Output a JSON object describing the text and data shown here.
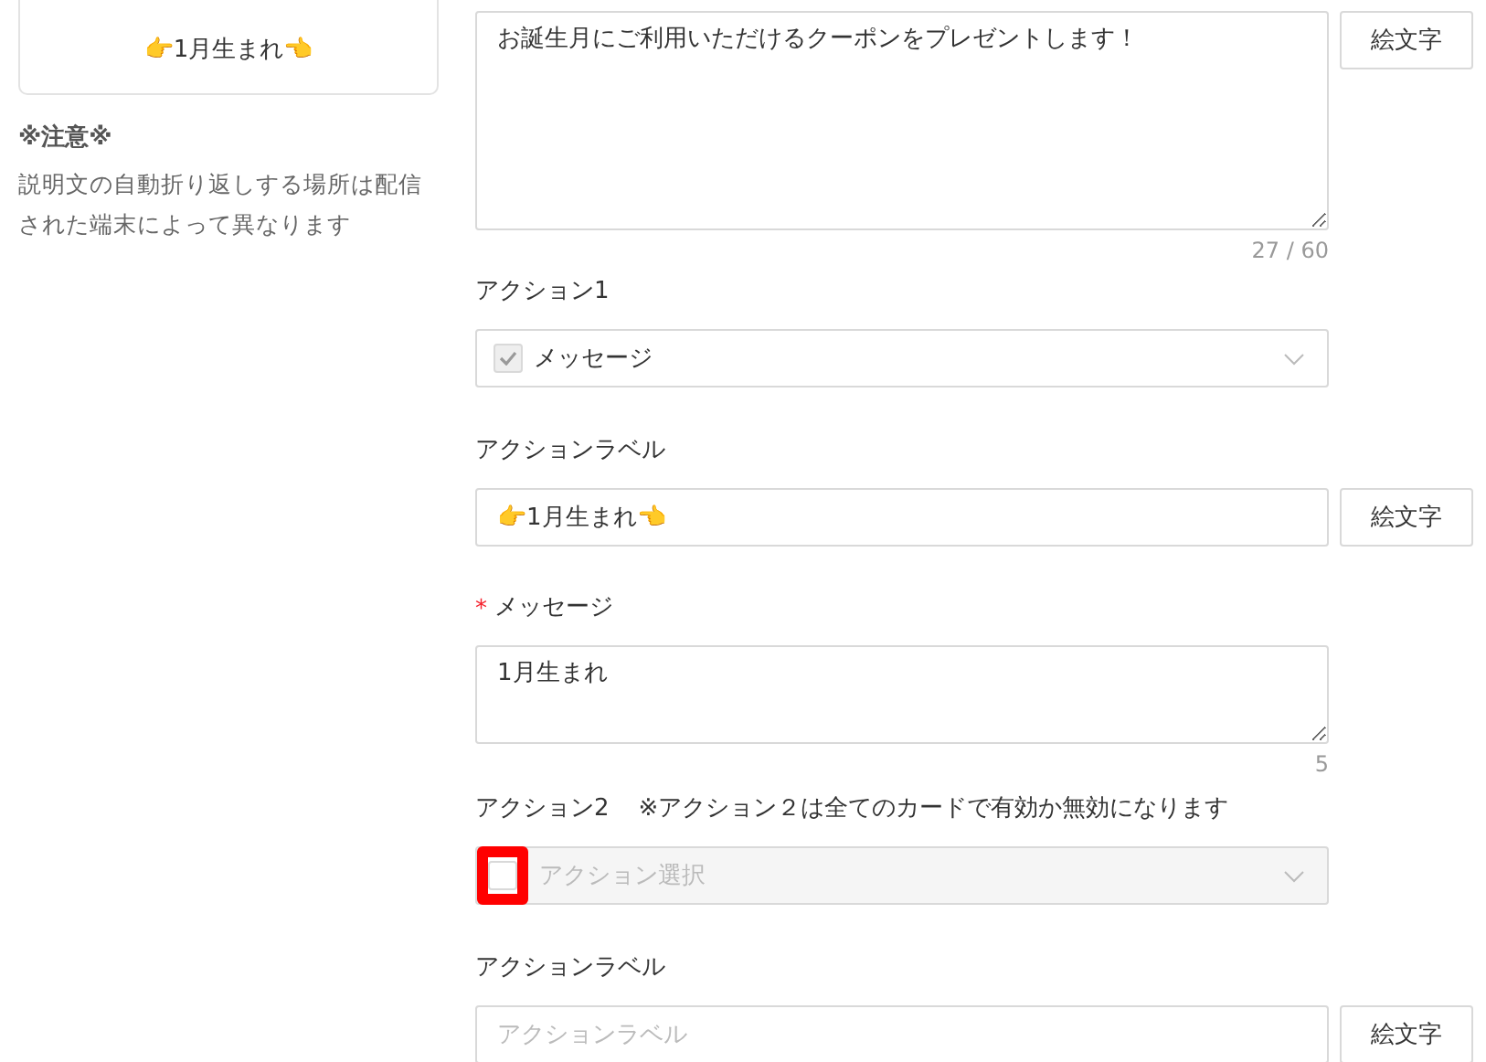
{
  "preview": {
    "label": "👉1月生まれ👈"
  },
  "notice": {
    "title": "※注意※",
    "body": "説明文の自動折り返しする場所は配信された端末によって異なります"
  },
  "description": {
    "value": "お誕生月にご利用いただけるクーポンをプレゼントします！",
    "counter": "27 / 60",
    "emoji_button": "絵文字"
  },
  "actions": [
    {
      "title": "アクション1",
      "checked": true,
      "disabled": false,
      "highlighted": false,
      "select_value": "メッセージ",
      "label_title": "アクションラベル",
      "label_value": "👉1月生まれ👈",
      "emoji_button": "絵文字",
      "message": {
        "title": "メッセージ",
        "required": true,
        "required_mark": "*",
        "value": "1月生まれ",
        "counter": "5"
      }
    },
    {
      "title": "アクション2",
      "note": "※アクション２は全てのカードで有効か無効になります",
      "checked": false,
      "disabled": true,
      "highlighted": true,
      "select_placeholder": "アクション選択",
      "label_title": "アクションラベル",
      "label_placeholder": "アクションラベル",
      "emoji_button": "絵文字"
    }
  ]
}
